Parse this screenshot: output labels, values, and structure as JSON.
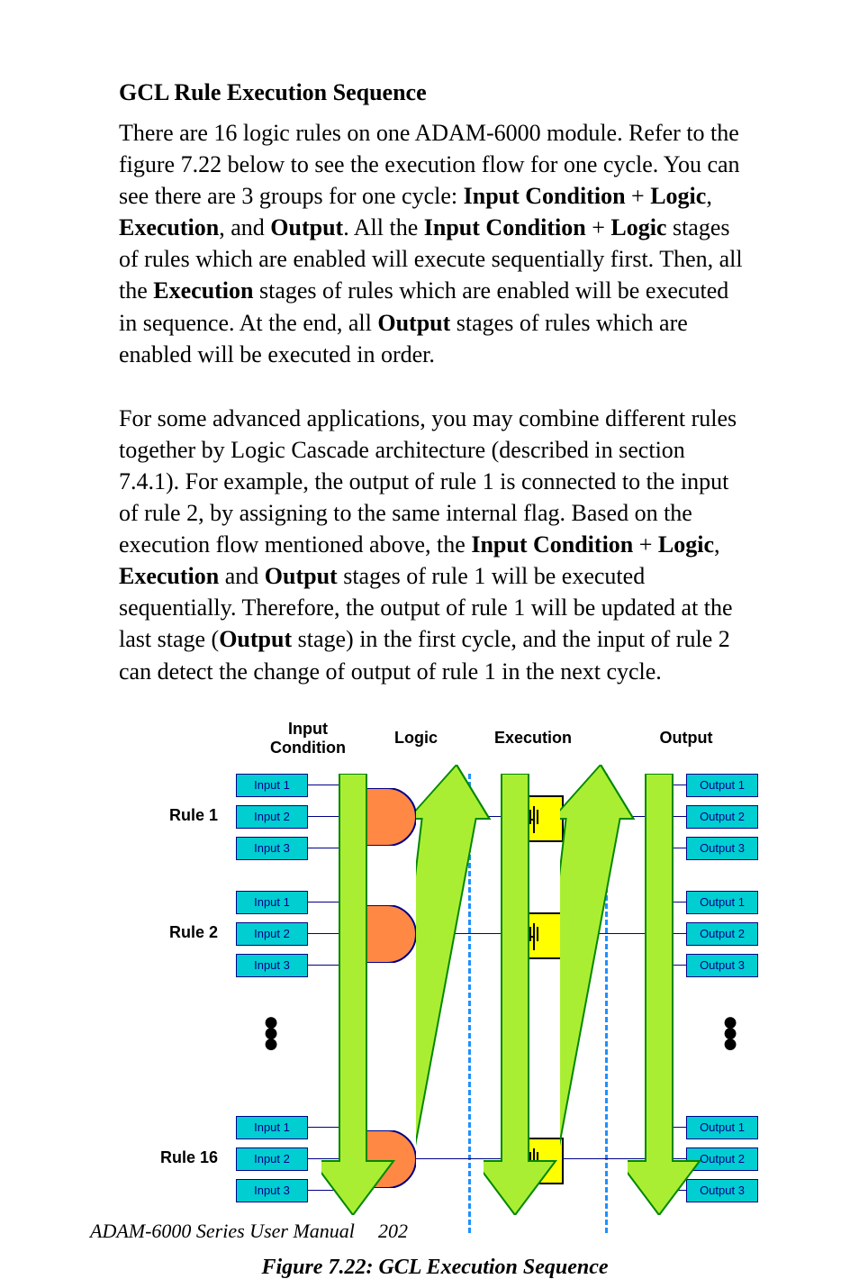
{
  "heading": "GCL Rule Execution Sequence",
  "para1_parts": {
    "p1": "There are 16 logic rules on one ADAM-6000 module. Refer to the figure 7.22 below to see the execution flow for one cycle. You can see there are 3 groups for one cycle: ",
    "b1": "Input Condition",
    "p2": " + ",
    "b2": "Logic",
    "p3": ", ",
    "b3": "Execution",
    "p4": ", and ",
    "b4": "Output",
    "p5": ". All the ",
    "b5": "Input Condition",
    "p6": " + ",
    "b6": "Logic",
    "p7": " stages of  rules which are enabled will execute sequentially first. Then, all the ",
    "b7": "Execution",
    "p8": " stages of  rules which are enabled will be executed in sequence. At the end, all ",
    "b8": "Output",
    "p9": " stages of rules which are enabled will be executed in order."
  },
  "para2_parts": {
    "p1": "For some advanced applications, you may combine different rules together by Logic Cascade architecture (described in section 7.4.1). For example, the output of rule 1 is connected to the input of rule 2, by assigning to the same internal flag. Based on the execution flow mentioned above, the ",
    "b1": "Input Condition",
    "p2": " + ",
    "b2": "Logic",
    "p3": ", ",
    "b3": "Execution",
    "p4": " and ",
    "b4": "Output",
    "p5": " stages of rule 1 will be executed sequentially. Therefore, the output of rule 1 will be updated at the last stage (",
    "b5": "Output",
    "p6": " stage) in the first cycle, and the input of rule 2 can detect the change of output of rule 1 in the next cycle."
  },
  "columns": {
    "c1a": "Input",
    "c1b": "Condition",
    "c2": "Logic",
    "c3": "Execution",
    "c4": "Output"
  },
  "rows": {
    "r1": "Rule 1",
    "r2": "Rule 2",
    "r3": "Rule 16"
  },
  "io": {
    "in1": "Input 1",
    "in2": "Input 2",
    "in3": "Input 3",
    "out1": "Output 1",
    "out2": "Output 2",
    "out3": "Output 3"
  },
  "figcaption": "Figure 7.22: GCL Execution Sequence",
  "footer": "ADAM-6000 Series User Manual",
  "page": "202"
}
